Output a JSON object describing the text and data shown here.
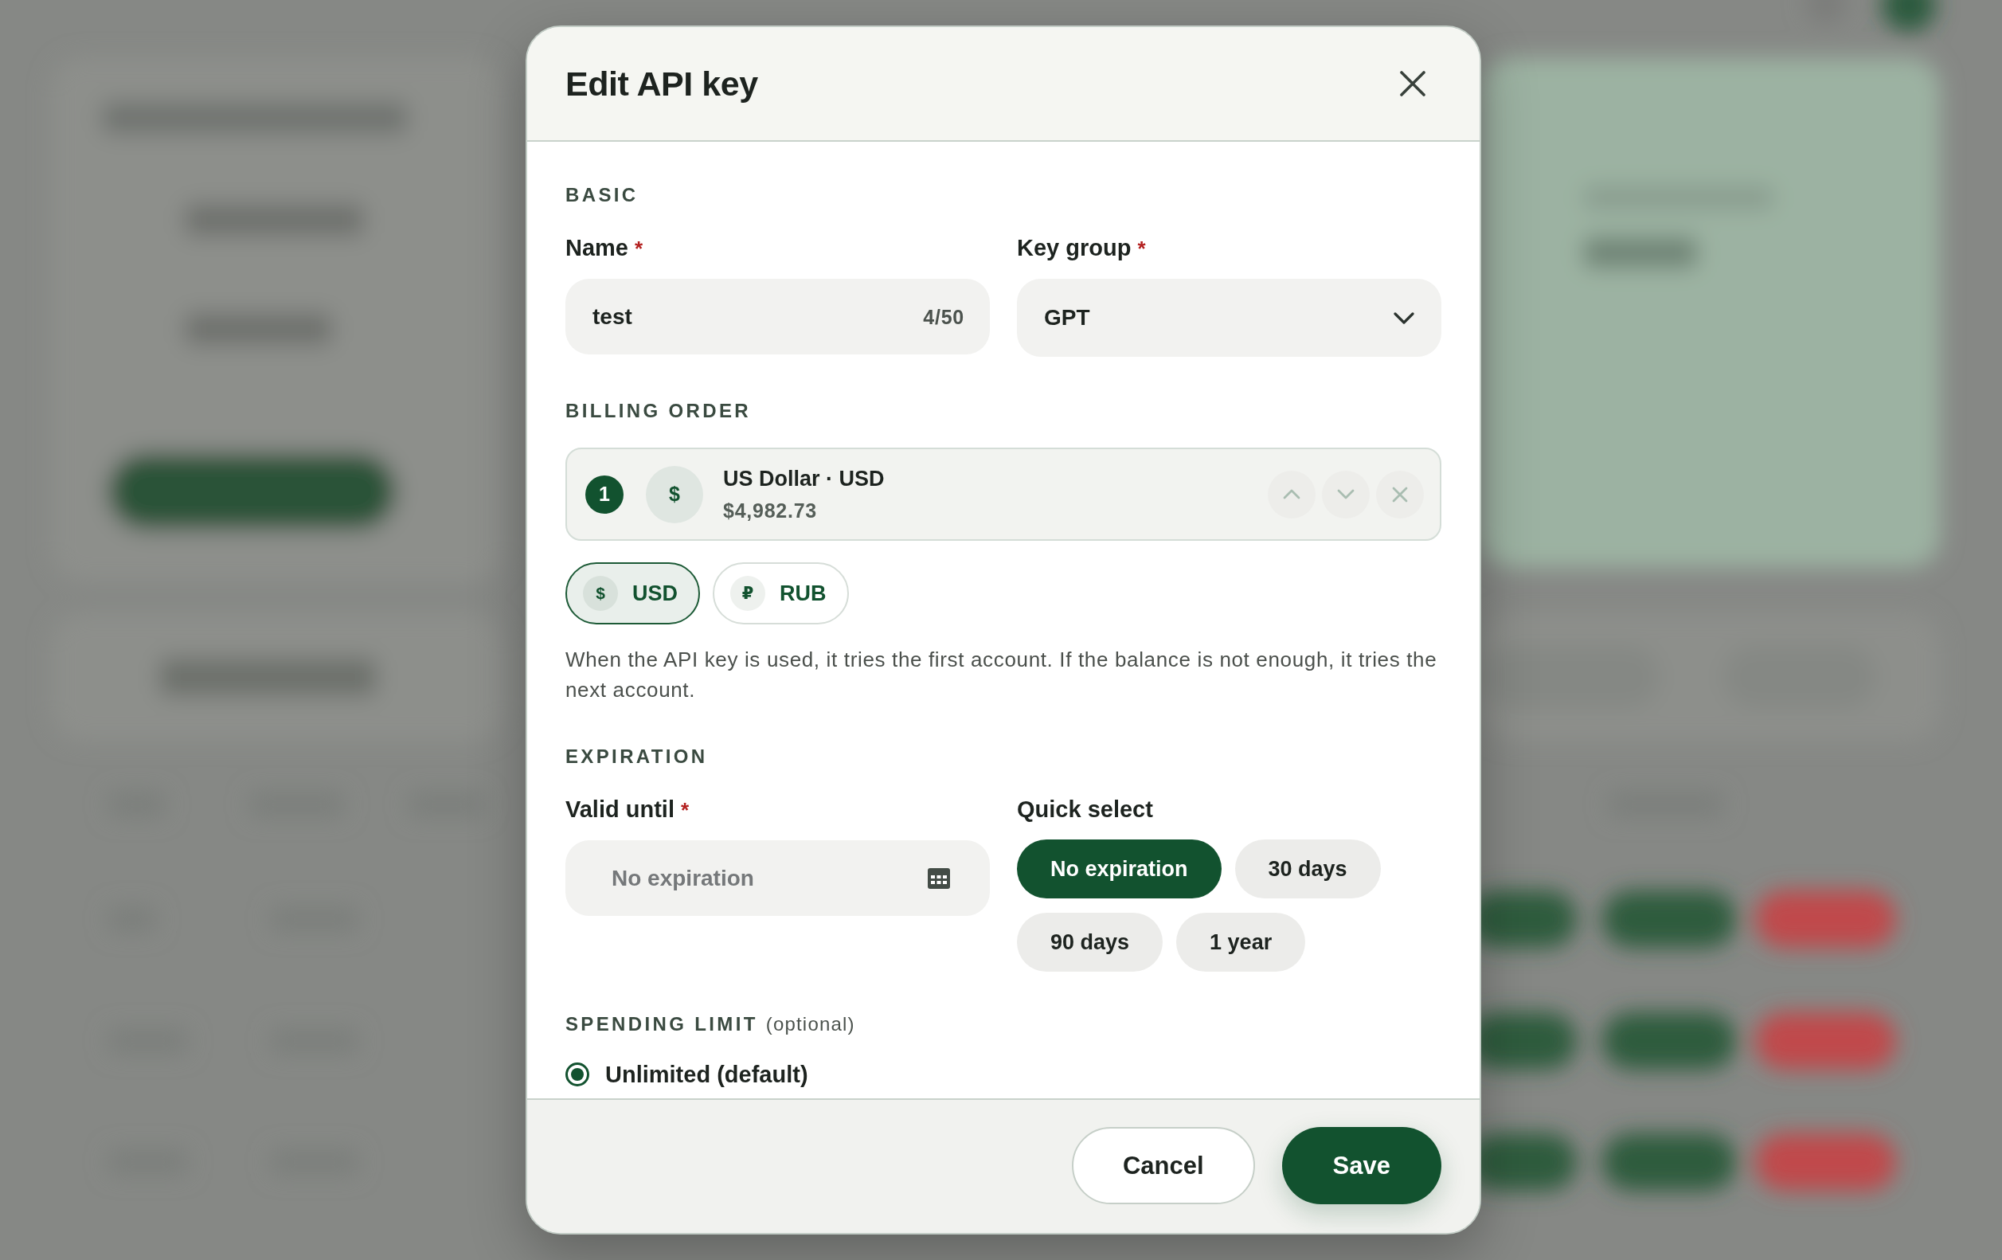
{
  "dialog": {
    "title": "Edit API key"
  },
  "basic": {
    "heading": "BASIC",
    "name_field": {
      "label": "Name",
      "required_mark": "*",
      "value": "test",
      "counter": "4/50"
    },
    "key_group_field": {
      "label": "Key group",
      "required_mark": "*",
      "value": "GPT"
    }
  },
  "billing_order": {
    "heading": "BILLING ORDER",
    "accounts": [
      {
        "rank": "1",
        "symbol": "$",
        "name": "US Dollar · USD",
        "balance": "$4,982.73"
      }
    ],
    "currencies": [
      {
        "symbol": "$",
        "code": "USD",
        "selected": true
      },
      {
        "symbol": "₽",
        "code": "RUB",
        "selected": false
      }
    ],
    "help_text": "When the API key is used, it tries the first account. If the balance is not enough, it tries the next account."
  },
  "expiration": {
    "heading": "EXPIRATION",
    "valid_until": {
      "label": "Valid until",
      "required_mark": "*",
      "placeholder": "No expiration"
    },
    "quick_select": {
      "label": "Quick select",
      "options": [
        {
          "label": "No expiration",
          "selected": true
        },
        {
          "label": "30 days",
          "selected": false
        },
        {
          "label": "90 days",
          "selected": false
        },
        {
          "label": "1 year",
          "selected": false
        }
      ]
    }
  },
  "spending_limit": {
    "heading": "SPENDING LIMIT",
    "note": "(optional)",
    "options": [
      {
        "label": "Unlimited (default)",
        "selected": true
      }
    ]
  },
  "footer": {
    "buttons": [
      {
        "label": "Cancel",
        "kind": "secondary"
      },
      {
        "label": "Save",
        "kind": "primary"
      }
    ]
  }
}
